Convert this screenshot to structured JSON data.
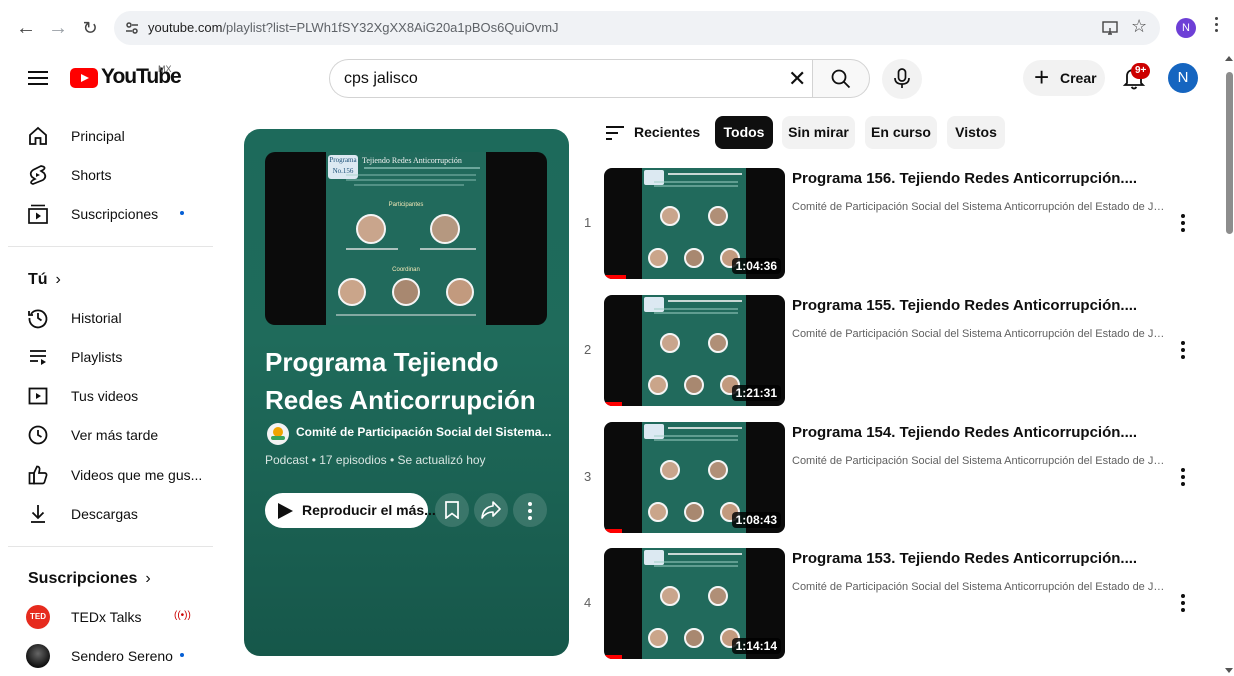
{
  "browser": {
    "url_host": "youtube.com",
    "url_path": "/playlist?list=PLWh1fSY32XgXX8AiG20a1pBOs6QuiOvmJ",
    "profile_initial": "N"
  },
  "header": {
    "logo_text": "YouTube",
    "country_code": "MX",
    "search_value": "cps jalisco",
    "create_label": "Crear",
    "notification_count": "9+",
    "avatar_initial": "N"
  },
  "sidebar": {
    "primary": [
      {
        "label": "Principal",
        "icon": "home-icon"
      },
      {
        "label": "Shorts",
        "icon": "shorts-icon"
      },
      {
        "label": "Suscripciones",
        "icon": "subscriptions-icon",
        "dot": true
      }
    ],
    "you_heading": "Tú",
    "you_items": [
      {
        "label": "Historial",
        "icon": "history-icon"
      },
      {
        "label": "Playlists",
        "icon": "playlists-icon"
      },
      {
        "label": "Tus videos",
        "icon": "your-videos-icon"
      },
      {
        "label": "Ver más tarde",
        "icon": "watch-later-icon"
      },
      {
        "label": "Videos que me gus...",
        "icon": "liked-icon"
      },
      {
        "label": "Descargas",
        "icon": "download-icon"
      }
    ],
    "subs_heading": "Suscripciones",
    "subs_items": [
      {
        "label": "TEDx Talks",
        "icon": "tedx-avatar",
        "live": true
      },
      {
        "label": "Sendero Sereno",
        "icon": "sendero-avatar",
        "dot": true
      }
    ]
  },
  "playlist": {
    "title": "Programa Tejiendo Redes Anticorrupción",
    "owner": "Comité de Participación Social del Sistema...",
    "meta": "Podcast • 17 episodios • Se actualizó hoy",
    "play_label": "Reproducir el más...",
    "poster_program": "Programa",
    "poster_number": "No.156",
    "poster_title": "Tejiendo Redes Anticorrupción",
    "poster_participants": "Participantes",
    "poster_coordinan": "Coordinan"
  },
  "filters": {
    "sort_label": "Recientes",
    "chips": [
      "Todos",
      "Sin mirar",
      "En curso",
      "Vistos"
    ],
    "active": "Todos"
  },
  "videos": [
    {
      "index": "1",
      "title": "Programa 156. Tejiendo Redes Anticorrupción....",
      "channel": "Comité de Participación Social del Sistema Anticorrupción del Estado de Jal...",
      "duration": "1:04:36",
      "progress": 0.12
    },
    {
      "index": "2",
      "title": "Programa 155. Tejiendo Redes Anticorrupción....",
      "channel": "Comité de Participación Social del Sistema Anticorrupción del Estado de Jal...",
      "duration": "1:21:31",
      "progress": 0.1
    },
    {
      "index": "3",
      "title": "Programa 154. Tejiendo Redes Anticorrupción....",
      "channel": "Comité de Participación Social del Sistema Anticorrupción del Estado de Jal...",
      "duration": "1:08:43",
      "progress": 0.1
    },
    {
      "index": "4",
      "title": "Programa 153. Tejiendo Redes Anticorrupción....",
      "channel": "Comité de Participación Social del Sistema Anticorrupción del Estado de Jal...",
      "duration": "1:14:14",
      "progress": 0.1
    }
  ],
  "colors": {
    "brand_red": "#ff0000",
    "playlist_green": "#1d6a5b",
    "link_blue": "#065fd4"
  }
}
